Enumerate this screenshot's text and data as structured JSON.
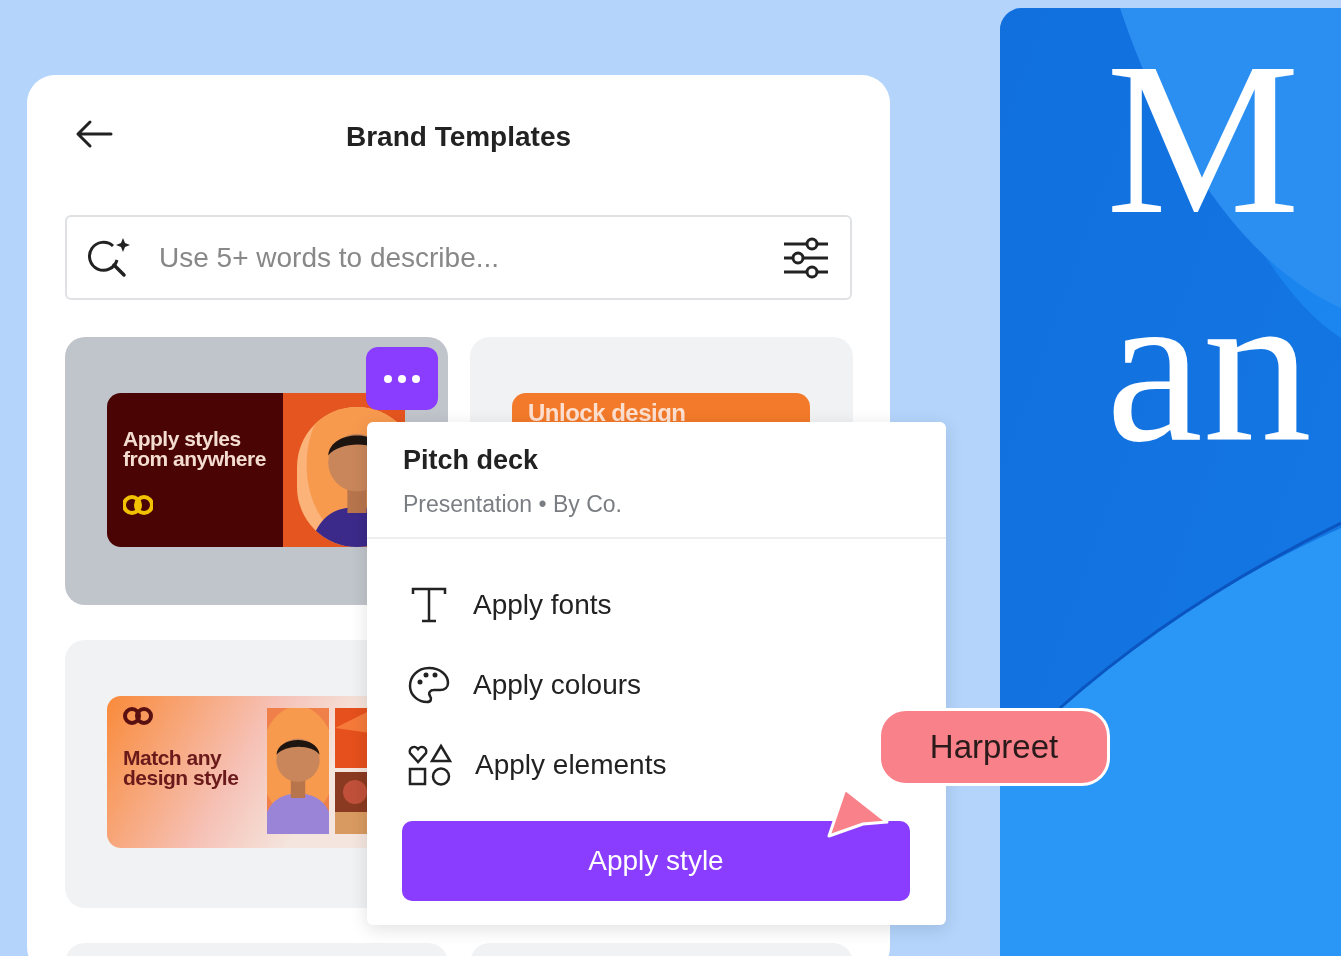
{
  "panel": {
    "title": "Brand Templates",
    "search": {
      "placeholder": "Use 5+ words to describe..."
    },
    "templates": [
      {
        "kind": "dark",
        "headline": "Apply styles from anywhere",
        "selected": true
      },
      {
        "kind": "banner",
        "headline": "Unlock design",
        "selected": false
      },
      {
        "kind": "gradient",
        "headline": "Match any design style",
        "selected": false
      },
      {
        "kind": "blank",
        "selected": false
      },
      {
        "kind": "blank",
        "selected": false
      }
    ]
  },
  "menu": {
    "title": "Pitch deck",
    "subtitle": "Presentation • By Co.",
    "items": [
      {
        "kind": "fonts",
        "label": "Apply fonts"
      },
      {
        "kind": "colours",
        "label": "Apply colours"
      },
      {
        "kind": "elements",
        "label": "Apply elements"
      }
    ],
    "button": "Apply style"
  },
  "cursor": {
    "name": "Harpreet"
  },
  "canvas": {
    "lines": [
      "M",
      "an"
    ]
  }
}
